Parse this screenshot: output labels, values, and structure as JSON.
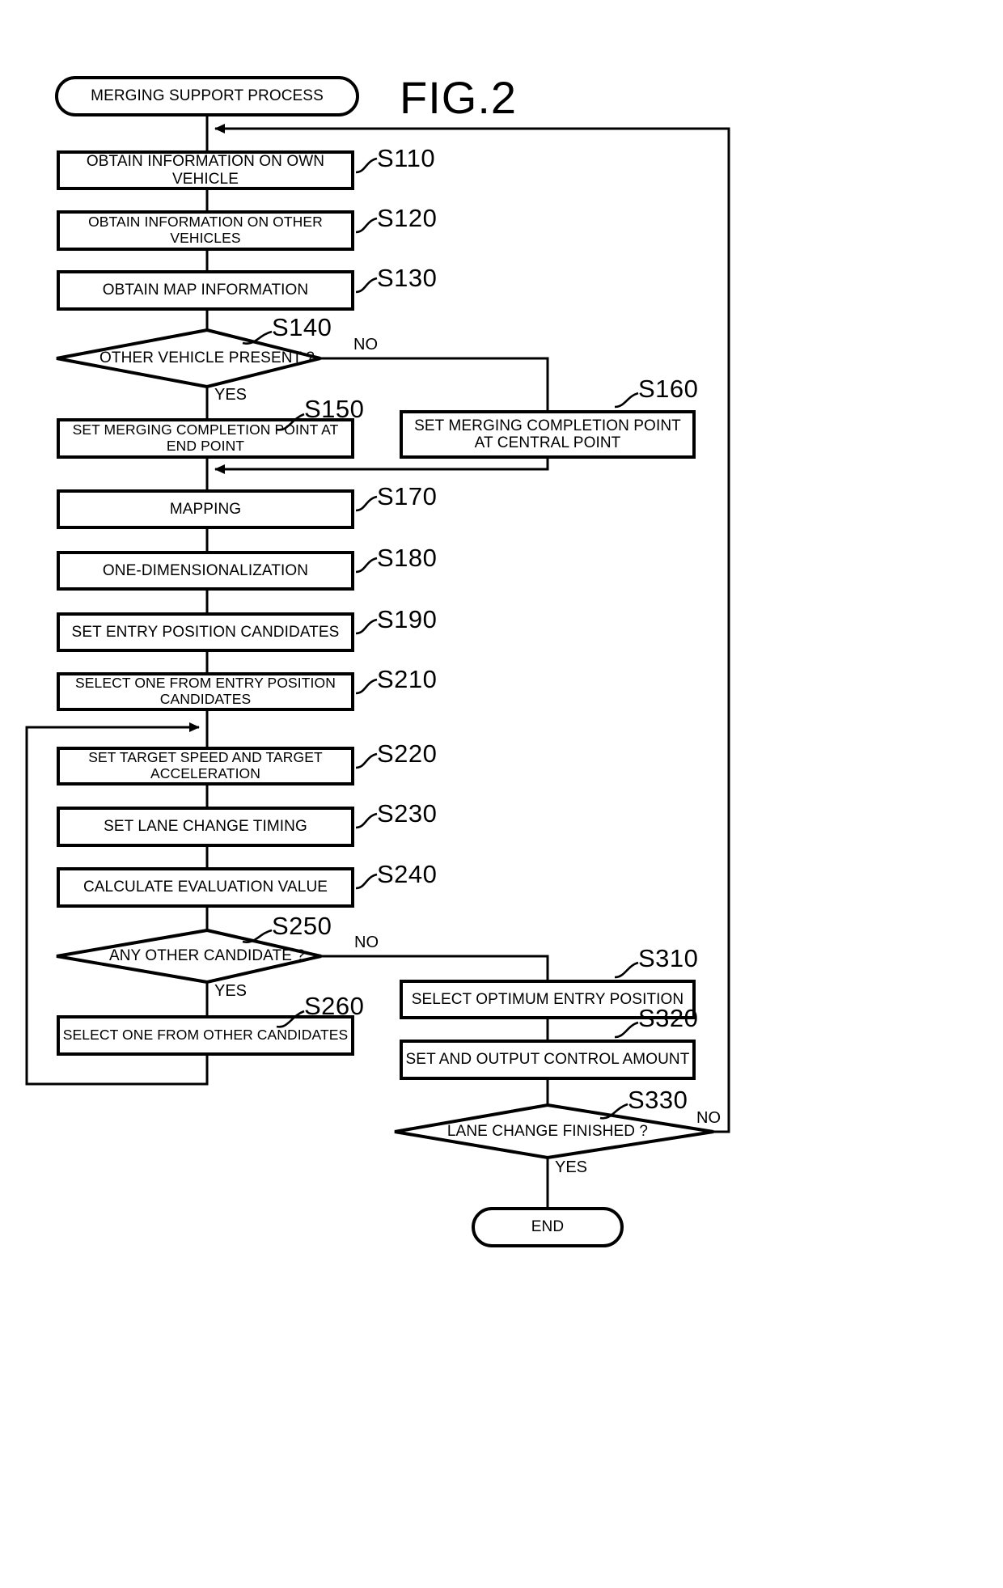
{
  "figure": {
    "title": "FIG.2"
  },
  "flowchart": {
    "type": "flowchart",
    "nodes": [
      {
        "id": "start",
        "shape": "terminator",
        "label": "MERGING SUPPORT PROCESS",
        "tag": ""
      },
      {
        "id": "s110",
        "shape": "process",
        "label": "OBTAIN INFORMATION ON OWN VEHICLE",
        "tag": "S110"
      },
      {
        "id": "s120",
        "shape": "process",
        "label": "OBTAIN INFORMATION ON OTHER VEHICLES",
        "tag": "S120"
      },
      {
        "id": "s130",
        "shape": "process",
        "label": "OBTAIN MAP INFORMATION",
        "tag": "S130"
      },
      {
        "id": "s140",
        "shape": "decision",
        "label": "OTHER VEHICLE PRESENT ?",
        "tag": "S140"
      },
      {
        "id": "s150",
        "shape": "process",
        "label": "SET MERGING COMPLETION POINT AT END POINT",
        "tag": "S150"
      },
      {
        "id": "s160",
        "shape": "process",
        "label": "SET MERGING COMPLETION POINT\nAT CENTRAL POINT",
        "tag": "S160"
      },
      {
        "id": "s170",
        "shape": "process",
        "label": "MAPPING",
        "tag": "S170"
      },
      {
        "id": "s180",
        "shape": "process",
        "label": "ONE-DIMENSIONALIZATION",
        "tag": "S180"
      },
      {
        "id": "s190",
        "shape": "process",
        "label": "SET ENTRY POSITION CANDIDATES",
        "tag": "S190"
      },
      {
        "id": "s210",
        "shape": "process",
        "label": "SELECT ONE FROM ENTRY POSITION CANDIDATES",
        "tag": "S210"
      },
      {
        "id": "s220",
        "shape": "process",
        "label": "SET TARGET SPEED AND TARGET ACCELERATION",
        "tag": "S220"
      },
      {
        "id": "s230",
        "shape": "process",
        "label": "SET LANE CHANGE TIMING",
        "tag": "S230"
      },
      {
        "id": "s240",
        "shape": "process",
        "label": "CALCULATE EVALUATION VALUE",
        "tag": "S240"
      },
      {
        "id": "s250",
        "shape": "decision",
        "label": "ANY OTHER CANDIDATE ?",
        "tag": "S250"
      },
      {
        "id": "s260",
        "shape": "process",
        "label": "SELECT ONE FROM OTHER CANDIDATES",
        "tag": "S260"
      },
      {
        "id": "s310",
        "shape": "process",
        "label": "SELECT OPTIMUM ENTRY POSITION",
        "tag": "S310"
      },
      {
        "id": "s320",
        "shape": "process",
        "label": "SET AND OUTPUT CONTROL AMOUNT",
        "tag": "S320"
      },
      {
        "id": "s330",
        "shape": "decision",
        "label": "LANE CHANGE FINISHED ?",
        "tag": "S330"
      },
      {
        "id": "end",
        "shape": "terminator",
        "label": "END",
        "tag": ""
      }
    ],
    "branch_labels": {
      "s140_no": "NO",
      "s140_yes": "YES",
      "s250_no": "NO",
      "s250_yes": "YES",
      "s330_no": "NO",
      "s330_yes": "YES"
    }
  }
}
